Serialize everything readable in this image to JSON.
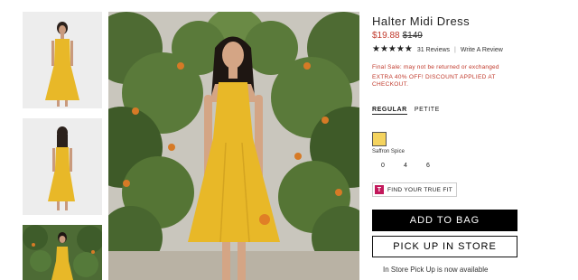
{
  "product": {
    "title": "Halter Midi Dress",
    "sale_price": "$19.88",
    "original_price": "$149",
    "stars": "★★★★★",
    "reviews": "31 Reviews",
    "separator": "|",
    "write_review": "Write A Review",
    "final_sale": "Final Sale: may not be returned or exchanged",
    "extra_discount": "EXTRA 40% OFF! DISCOUNT APPLIED AT CHECKOUT."
  },
  "size_types": {
    "regular": "REGULAR",
    "petite": "PETITE"
  },
  "color": {
    "name": "Saffron Spice",
    "swatch_hex": "#f4d35e"
  },
  "sizes": [
    "0",
    "4",
    "6"
  ],
  "true_fit": {
    "badge": "T",
    "label": "FIND YOUR TRUE FIT"
  },
  "actions": {
    "add_to_bag": "ADD TO BAG",
    "pick_up": "PICK UP IN STORE"
  },
  "store_note": "In Store Pick Up is now available"
}
